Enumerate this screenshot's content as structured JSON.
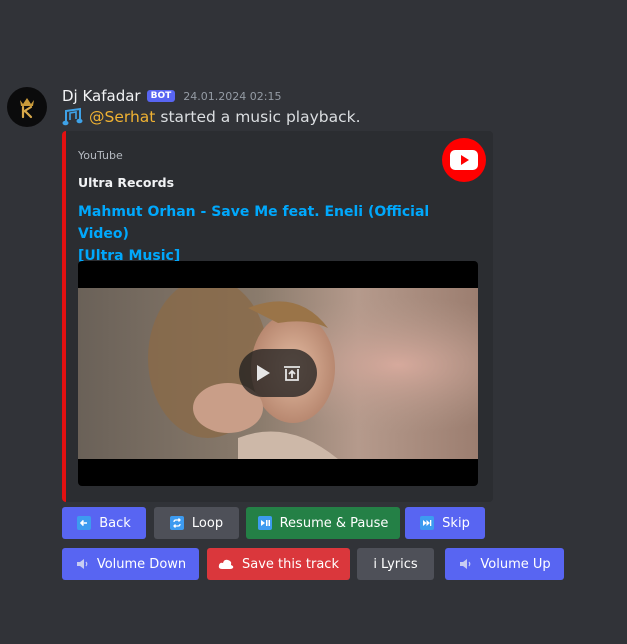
{
  "message": {
    "username": "Dj Kafadar",
    "bot_badge": "BOT",
    "timestamp": "24.01.2024 02:15",
    "mention": "@Serhat",
    "text": "started a music playback."
  },
  "embed": {
    "provider": "YouTube",
    "author": "Ultra Records",
    "title_line1": "Mahmut Orhan - Save Me feat. Eneli (Official Video)",
    "title_line2": "[Ultra Music]",
    "accent_color": "#e21111"
  },
  "buttons_row1": [
    {
      "label": "Back",
      "icon": "back-arrow-icon"
    },
    {
      "label": "Loop",
      "icon": "loop-icon"
    },
    {
      "label": "Resume & Pause",
      "icon": "play-pause-icon"
    },
    {
      "label": "Skip",
      "icon": "fast-forward-icon"
    }
  ],
  "buttons_row2": [
    {
      "label": "Volume Down",
      "icon": "speaker-icon"
    },
    {
      "label": "Save this track",
      "icon": "cloud-icon"
    },
    {
      "label": "i Lyrics",
      "icon": ""
    },
    {
      "label": "Volume Up",
      "icon": "speaker-icon"
    }
  ]
}
